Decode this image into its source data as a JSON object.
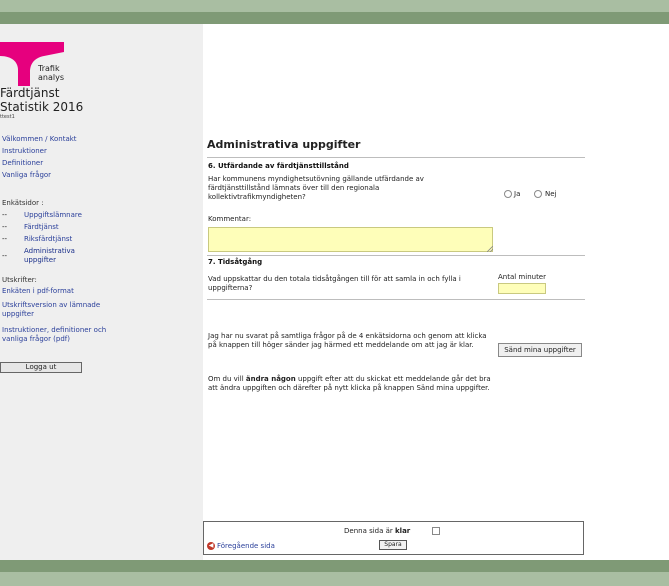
{
  "app": {
    "logo_text_1": "Trafik",
    "logo_text_2": "analys",
    "title_line1": "Färdtjänst",
    "title_line2": "Statistik 2016",
    "user": "ttest1",
    "brand_color": "#e6007e"
  },
  "sidebar": {
    "links": [
      "Välkommen / Kontakt",
      "Instruktioner",
      "Definitioner",
      "Vanliga frågor"
    ],
    "enkat_header": "Enkätsidor :",
    "dash": "--",
    "enkat_items": [
      "Uppgiftslämnare",
      "Färdtjänst",
      "Riksfärdtjänst",
      "Administrativa uppgifter"
    ],
    "utskrifter_header": "Utskrifter:",
    "utskrifter": [
      "Enkäten i pdf-format",
      "Utskriftsversion av lämnade uppgifter",
      "Instruktioner, definitioner och vanliga frågor (pdf)"
    ],
    "logout_label": "Logga ut"
  },
  "main": {
    "title": "Administrativa uppgifter",
    "q6_title": "6. Utfärdande av färdtjänsttillstånd",
    "q6_text": "Har kommunens myndighetsutövning gällande utfärdande av färdtjänsttillstånd lämnats över till den regionala kollektivtrafikmyndigheten?",
    "yes_label": "Ja",
    "no_label": "Nej",
    "comment_label": "Kommentar:",
    "comment_value": "",
    "q7_title": "7. Tidsåtgång",
    "q7_text": "Vad uppskattar du den totala tidsåtgången till för att samla in och fylla i uppgifterna?",
    "minutes_label": "Antal minuter",
    "minutes_value": "",
    "submit_text": "Jag har nu svarat på samtliga frågor på de 4 enkätsidorna och genom att klicka på knappen till höger sänder jag härmed ett meddelande om att jag är klar.",
    "submit_button": "Sänd mina uppgifter",
    "change_text_pre": "Om du vill ",
    "change_text_bold": "ändra någon",
    "change_text_post": " uppgift efter att du skickat ett meddelande går det bra att ändra uppgiften och därefter på nytt klicka på knappen Sänd mina uppgifter."
  },
  "footer": {
    "ready_pre": "Denna sida är ",
    "ready_bold": "klar",
    "save_button": "Spara",
    "prev_label": "Föregående sida"
  }
}
